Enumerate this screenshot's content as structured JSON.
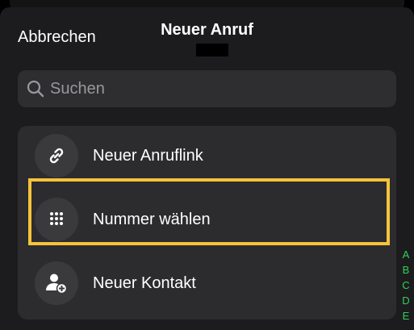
{
  "header": {
    "cancel_label": "Abbrechen",
    "title": "Neuer Anruf"
  },
  "search": {
    "placeholder": "Suchen",
    "value": ""
  },
  "actions": [
    {
      "label": "Neuer Anruflink",
      "icon": "link-icon"
    },
    {
      "label": "Nummer wählen",
      "icon": "keypad-icon",
      "highlighted": true
    },
    {
      "label": "Neuer Kontakt",
      "icon": "add-contact-icon"
    }
  ],
  "index_letters": [
    "A",
    "B",
    "C",
    "D",
    "E"
  ],
  "colors": {
    "background": "#000000",
    "sheet": "#1c1c1e",
    "card": "#2c2c2e",
    "highlight": "#f5c33b",
    "index_accent": "#2fd158"
  }
}
